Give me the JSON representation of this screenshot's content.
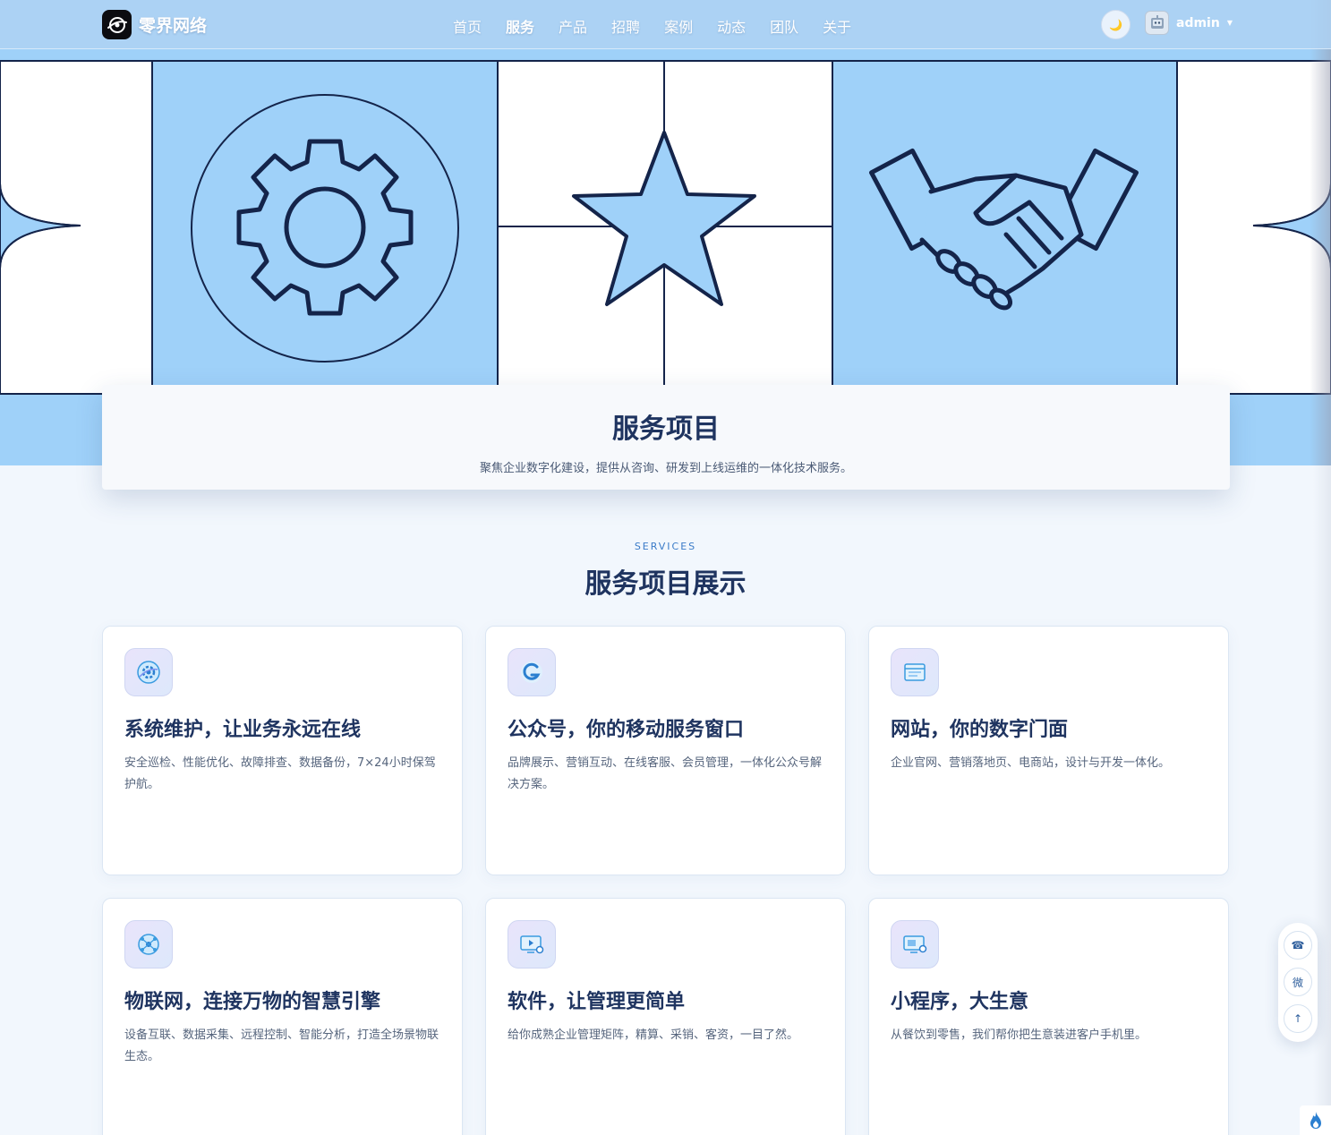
{
  "brand": {
    "name": "零界网络"
  },
  "nav": {
    "items": [
      {
        "label": "首页",
        "active": false
      },
      {
        "label": "服务",
        "active": true
      },
      {
        "label": "产品",
        "active": false
      },
      {
        "label": "招聘",
        "active": false
      },
      {
        "label": "案例",
        "active": false
      },
      {
        "label": "动态",
        "active": false
      },
      {
        "label": "团队",
        "active": false
      },
      {
        "label": "关于",
        "active": false
      }
    ],
    "theme_icon": "moon-icon",
    "theme_glyph": "🌙",
    "user": {
      "name": "admin",
      "avatar_icon": "robot-avatar-icon"
    }
  },
  "hero": {
    "illustrations": [
      "gear-icon",
      "star-icon",
      "handshake-icon"
    ],
    "colors": {
      "panel": "#9fd1f9",
      "line": "#14244a",
      "blank": "#ffffff"
    }
  },
  "intro": {
    "title": "服务项目",
    "subtitle": "聚焦企业数字化建设，提供从咨询、研发到上线运维的一体化技术服务。"
  },
  "section": {
    "kicker": "SERVICES",
    "title": "服务项目展示"
  },
  "cards": [
    {
      "icon": "gear-sphere-icon",
      "title": "系统维护，让业务永远在线",
      "desc": "安全巡检、性能优化、故障排查、数据备份，7×24小时保驾护航。"
    },
    {
      "icon": "wechat-official-icon",
      "title": "公众号，你的移动服务窗口",
      "desc": "品牌展示、营销互动、在线客服、会员管理，一体化公众号解决方案。"
    },
    {
      "icon": "browser-window-icon",
      "title": "网站，你的数字门面",
      "desc": "企业官网、营销落地页、电商站，设计与开发一体化。"
    },
    {
      "icon": "iot-network-icon",
      "title": "物联网，连接万物的智慧引擎",
      "desc": "设备互联、数据采集、远程控制、智能分析，打造全场景物联生态。"
    },
    {
      "icon": "software-monitor-icon",
      "title": "软件，让管理更简单",
      "desc": "给你成熟企业管理矩阵，精算、采销、客资，一目了然。"
    },
    {
      "icon": "mini-program-icon",
      "title": "小程序，大生意",
      "desc": "从餐饮到零售，我们帮你把生意装进客户手机里。"
    }
  ],
  "side_tools": [
    {
      "icon": "phone-icon",
      "glyph": "☎"
    },
    {
      "icon": "wechat-icon",
      "glyph": "微"
    },
    {
      "icon": "back-to-top-icon",
      "glyph": "↑"
    }
  ],
  "corner_icon": "fire-icon",
  "colors": {
    "accent": "#3a7bc8",
    "heading": "#1f3460",
    "text": "#56657d",
    "page_bg": "#f2f7fd"
  }
}
